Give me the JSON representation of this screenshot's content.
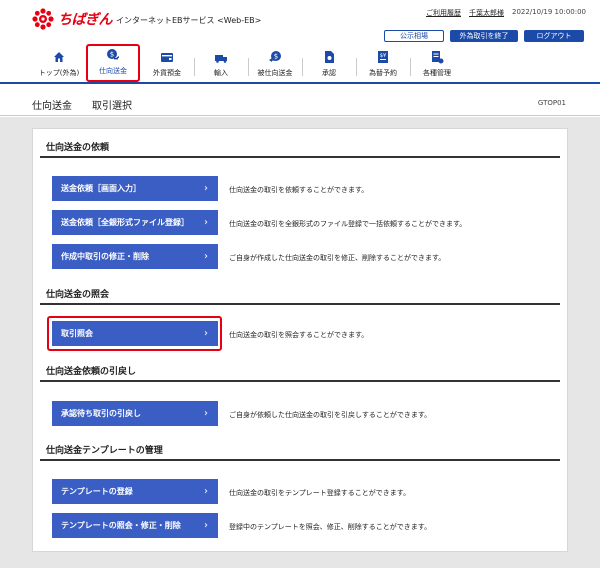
{
  "header": {
    "brand": "ちばぎん",
    "service_name": "インターネットEBサービス <Web-EB>",
    "links": {
      "usage_history": "ご利用履歴",
      "user_name": "千葉太郎様",
      "datetime": "2022/10/19 10:00:00"
    },
    "buttons": {
      "market_rate": "公示相場",
      "end_fx": "外為取引を終了",
      "logout": "ログアウト"
    }
  },
  "nav": {
    "items": [
      {
        "label": "トップ(外為)",
        "icon": "home-icon"
      },
      {
        "label": "仕向送金",
        "icon": "remittance-icon",
        "active": true
      },
      {
        "label": "外貨預金",
        "icon": "deposit-icon"
      },
      {
        "label": "輸入",
        "icon": "import-icon"
      },
      {
        "label": "被仕向送金",
        "icon": "incoming-icon"
      },
      {
        "label": "承認",
        "icon": "approval-icon"
      },
      {
        "label": "為替予約",
        "icon": "fx-contract-icon"
      },
      {
        "label": "各種管理",
        "icon": "management-icon"
      }
    ]
  },
  "titlebar": {
    "category": "仕向送金",
    "page": "取引選択",
    "screen_code": "GTOP01"
  },
  "sections": [
    {
      "title": "仕向送金の依頼",
      "items": [
        {
          "button": "送金依頼［画面入力］",
          "desc": "仕向送金の取引を依頼することができます。"
        },
        {
          "button": "送金依頼［全銀形式ファイル登録］",
          "desc": "仕向送金の取引を全銀形式のファイル登録で一括依頼することができます。"
        },
        {
          "button": "作成中取引の修正・削除",
          "desc": "ご自身が作成した仕向送金の取引を修正、削除することができます。"
        }
      ]
    },
    {
      "title": "仕向送金の照会",
      "items": [
        {
          "button": "取引照会",
          "desc": "仕向送金の取引を照会することができます。"
        }
      ]
    },
    {
      "title": "仕向送金依頼の引戻し",
      "items": [
        {
          "button": "承認待ち取引の引戻し",
          "desc": "ご自身が依頼した仕向送金の取引を引戻しすることができます。"
        }
      ]
    },
    {
      "title": "仕向送金テンプレートの管理",
      "items": [
        {
          "button": "テンプレートの登録",
          "desc": "仕向送金の取引をテンプレート登録することができます。"
        },
        {
          "button": "テンプレートの照会・修正・削除",
          "desc": "登録中のテンプレートを照会、修正、削除することができます。"
        }
      ]
    }
  ],
  "colors": {
    "brand_red": "#e60012",
    "primary_blue": "#1b4aa8",
    "button_blue": "#3a5ec3"
  }
}
